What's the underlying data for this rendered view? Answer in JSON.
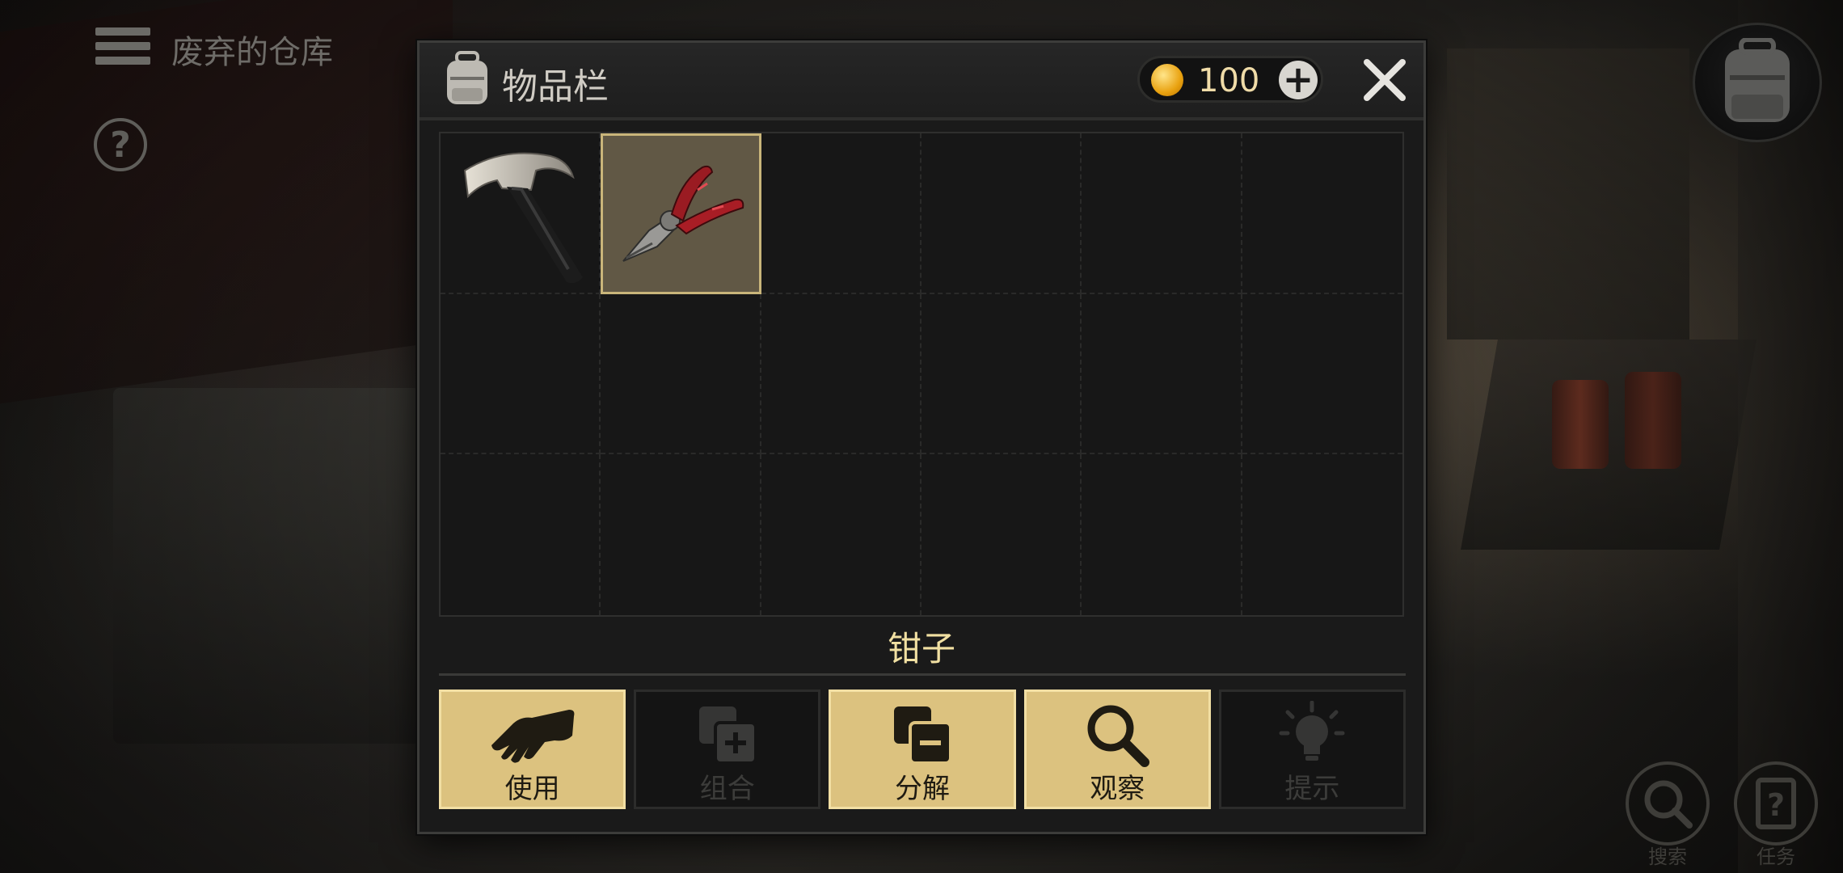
{
  "hud": {
    "location_title": "废弃的仓库",
    "help_glyph": "?",
    "search_label": "搜索",
    "tasks_label": "任务"
  },
  "inventory": {
    "title": "物品栏",
    "coins": "100",
    "coin_add_glyph": "+",
    "selected_item_name": "钳子",
    "slots": [
      {
        "item": "hammer-icon",
        "selected": false
      },
      {
        "item": "pliers-icon",
        "selected": true
      }
    ]
  },
  "actions": [
    {
      "label": "使用",
      "icon": "hand-icon",
      "enabled": true
    },
    {
      "label": "组合",
      "icon": "combine-icon",
      "enabled": false
    },
    {
      "label": "分解",
      "icon": "split-icon",
      "enabled": true
    },
    {
      "label": "观察",
      "icon": "magnifier-icon",
      "enabled": true
    },
    {
      "label": "提示",
      "icon": "lightbulb-icon",
      "enabled": false
    }
  ],
  "colors": {
    "button_active": "#dcc27f",
    "selected_slot": "#615845",
    "item_name": "#f1e0a2"
  }
}
